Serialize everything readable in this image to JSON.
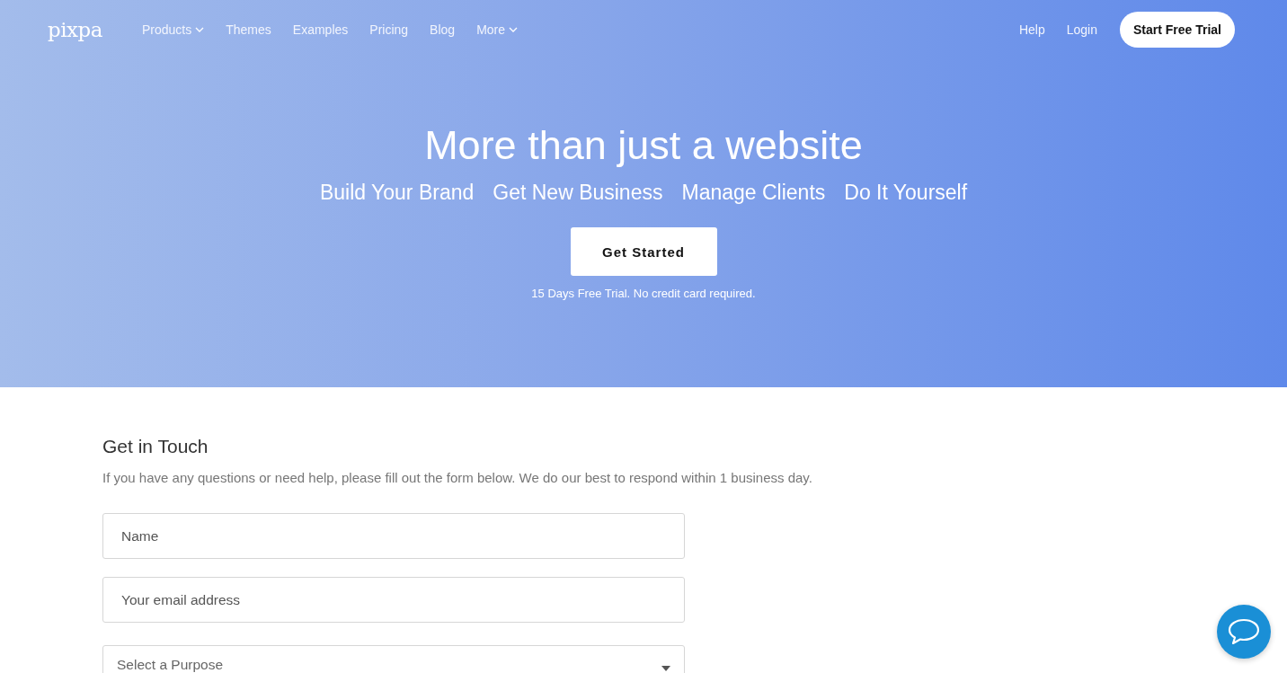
{
  "nav": {
    "logo": "pixpa",
    "links": [
      {
        "label": "Products",
        "dropdown": true
      },
      {
        "label": "Themes",
        "dropdown": false
      },
      {
        "label": "Examples",
        "dropdown": false
      },
      {
        "label": "Pricing",
        "dropdown": false
      },
      {
        "label": "Blog",
        "dropdown": false
      },
      {
        "label": "More",
        "dropdown": true
      }
    ],
    "right_links": [
      "Help",
      "Login"
    ],
    "cta": "Start Free Trial"
  },
  "hero": {
    "title": "More than just a website",
    "taglines": [
      "Build Your Brand",
      "Get New Business",
      "Manage Clients",
      "Do It Yourself"
    ],
    "button": "Get Started",
    "note": "15 Days Free Trial. No credit card required."
  },
  "contact": {
    "title": "Get in Touch",
    "intro": "If you have any questions or need help, please fill out the form below. We do our best to respond within 1 business day.",
    "fields": [
      {
        "kind": "text",
        "placeholder": "Name"
      },
      {
        "kind": "text",
        "placeholder": "Your email address"
      },
      {
        "kind": "select",
        "placeholder": "Select a Purpose"
      }
    ]
  }
}
